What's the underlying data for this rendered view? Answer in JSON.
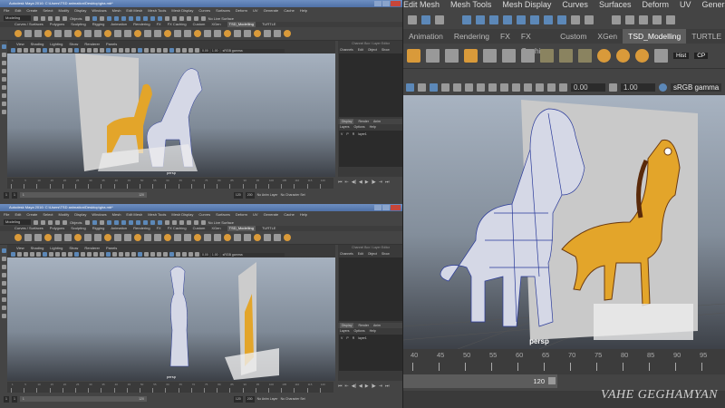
{
  "window_title": "Autodesk Maya 2016: C:\\Users\\TSD animation\\Desktop\\gira.mb*",
  "menus": [
    "File",
    "Edit",
    "Create",
    "Select",
    "Modify",
    "Display",
    "Windows",
    "Mesh",
    "Edit Mesh",
    "Mesh Tools",
    "Mesh Display",
    "Curves",
    "Surfaces",
    "Deform",
    "UV",
    "Generate",
    "Cache",
    "Help"
  ],
  "toolbar": {
    "mode": "Modeling",
    "objects": "Objects",
    "live_surface": "No Live Surface"
  },
  "shelf_tabs": [
    "Curves / Surfaces",
    "Polygons",
    "Sculpting",
    "Rigging",
    "Animation",
    "Rendering",
    "FX",
    "FX Caching",
    "Custom",
    "XGen",
    "TSD_Modelling",
    "TURTLE"
  ],
  "active_shelf": "TSD_Modelling",
  "shelf_labels": {
    "hist": "Hist",
    "cp": "CP"
  },
  "panel_menu": [
    "View",
    "Shading",
    "Lighting",
    "Show",
    "Renderer",
    "Panels"
  ],
  "viewport": {
    "exposure": "0.00",
    "gamma": "1.00",
    "color_space": "sRGB gamma",
    "camera": "persp"
  },
  "channel_box": {
    "title": "Channel Box / Layer Editor",
    "menu": [
      "Channels",
      "Edit",
      "Object",
      "Show"
    ],
    "tabs": [
      "Display",
      "Render",
      "Anim"
    ],
    "layer_menu": [
      "Layers",
      "Options",
      "Help"
    ],
    "layer_flags": [
      "V",
      "P",
      "R"
    ],
    "layer": "layer1"
  },
  "timeline": {
    "small_ticks": [
      "1",
      "5",
      "10",
      "15",
      "20",
      "25",
      "30",
      "35",
      "40",
      "45",
      "50",
      "55",
      "60",
      "65",
      "70",
      "75",
      "80",
      "85",
      "90",
      "95",
      "100",
      "105",
      "110",
      "115",
      "120"
    ],
    "zoom_ticks": [
      "40",
      "45",
      "50",
      "55",
      "60",
      "65",
      "70",
      "75",
      "80",
      "85",
      "90",
      "95"
    ],
    "current_frame": "1"
  },
  "range": {
    "start": "1",
    "current": "1",
    "slider_start": "1",
    "slider_end": "120",
    "end": "120",
    "max": "200",
    "anim_layer": "No Anim Layer",
    "character_set": "No Character Set"
  },
  "playback_icons": [
    "go-start",
    "step-back-key",
    "step-back",
    "play-back",
    "play-forward",
    "step-forward",
    "step-forward-key",
    "go-end"
  ],
  "watermark": "VAHE GEGHAMYAN",
  "colors": {
    "accent": "#5c88b8",
    "giraffe": "#e3a52a",
    "title": "#4f70a6"
  }
}
